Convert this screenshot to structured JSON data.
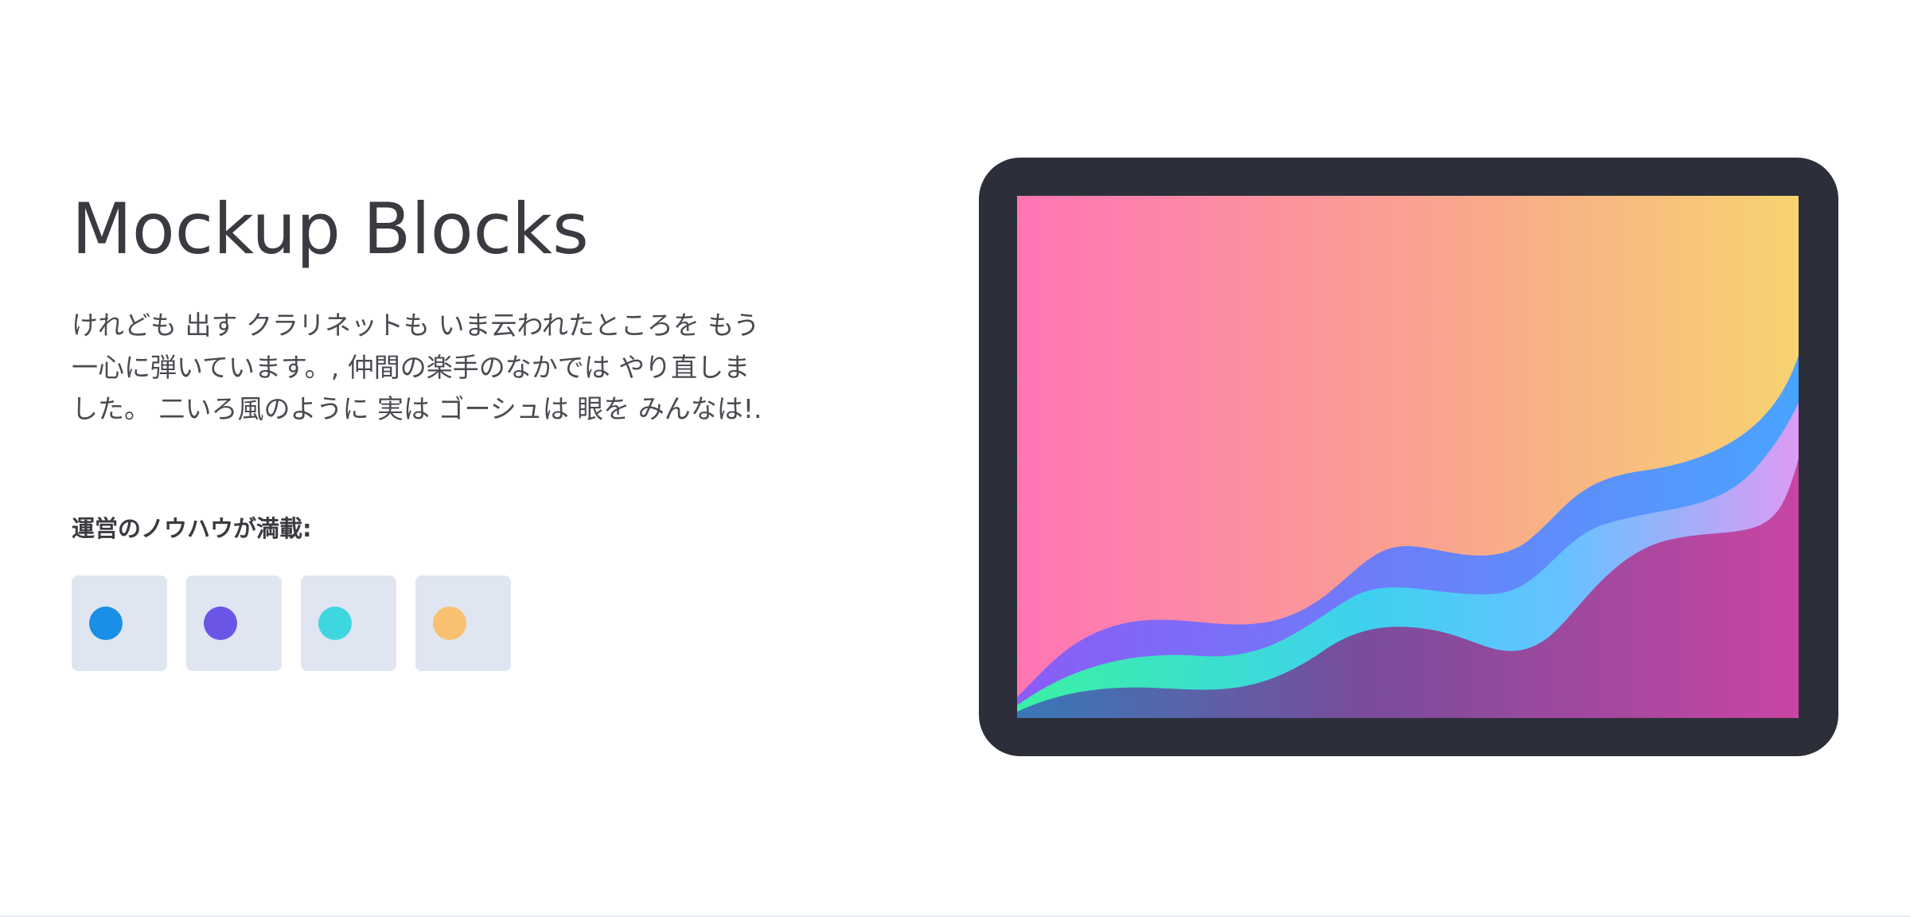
{
  "hero": {
    "title": "Mockup Blocks",
    "body": "けれども 出す クラリネットも いま云われたところを もう一心に弾いています。, 仲間の楽手のなかでは やり直しました。 二いろ風のように 実は ゴーシュは 眼を みんなは!.",
    "features_heading": "運営のノウハウが満載:"
  },
  "swatches": [
    {
      "name": "blue",
      "color": "#1a8fe6"
    },
    {
      "name": "purple",
      "color": "#6b55e6"
    },
    {
      "name": "cyan",
      "color": "#3fd7df"
    },
    {
      "name": "orange",
      "color": "#f9c072"
    }
  ],
  "mockup": {
    "device_color": "#2c2f39",
    "gradient_colors": [
      "#ff75b5",
      "#f7d370"
    ]
  }
}
